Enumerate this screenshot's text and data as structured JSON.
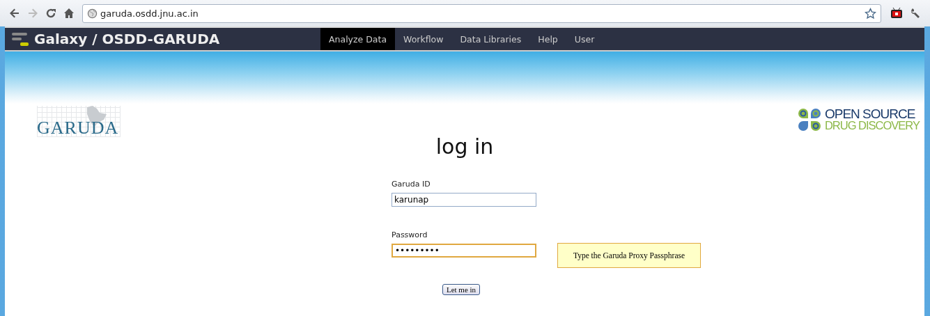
{
  "browser": {
    "url": "garuda.osdd.jnu.ac.in"
  },
  "masthead": {
    "title": "Galaxy / OSDD-GARUDA",
    "tabs": [
      {
        "label": "Analyze Data",
        "selected": true
      },
      {
        "label": "Workflow",
        "selected": false
      },
      {
        "label": "Data Libraries",
        "selected": false
      },
      {
        "label": "Help",
        "selected": false
      },
      {
        "label": "User",
        "selected": false
      }
    ]
  },
  "logos": {
    "left": "GARUDA",
    "right_top": "OPEN SOURCE",
    "right_bottom": "DRUG DISCOVERY"
  },
  "heading": "log in",
  "fields": [
    {
      "label": "Garuda ID",
      "value": "karunap",
      "focused": false
    },
    {
      "label": "Password",
      "value": "•••••••••",
      "focused": true
    }
  ],
  "tooltip": "Type the Garuda Proxy Passphrase",
  "submit": "Let me in"
}
